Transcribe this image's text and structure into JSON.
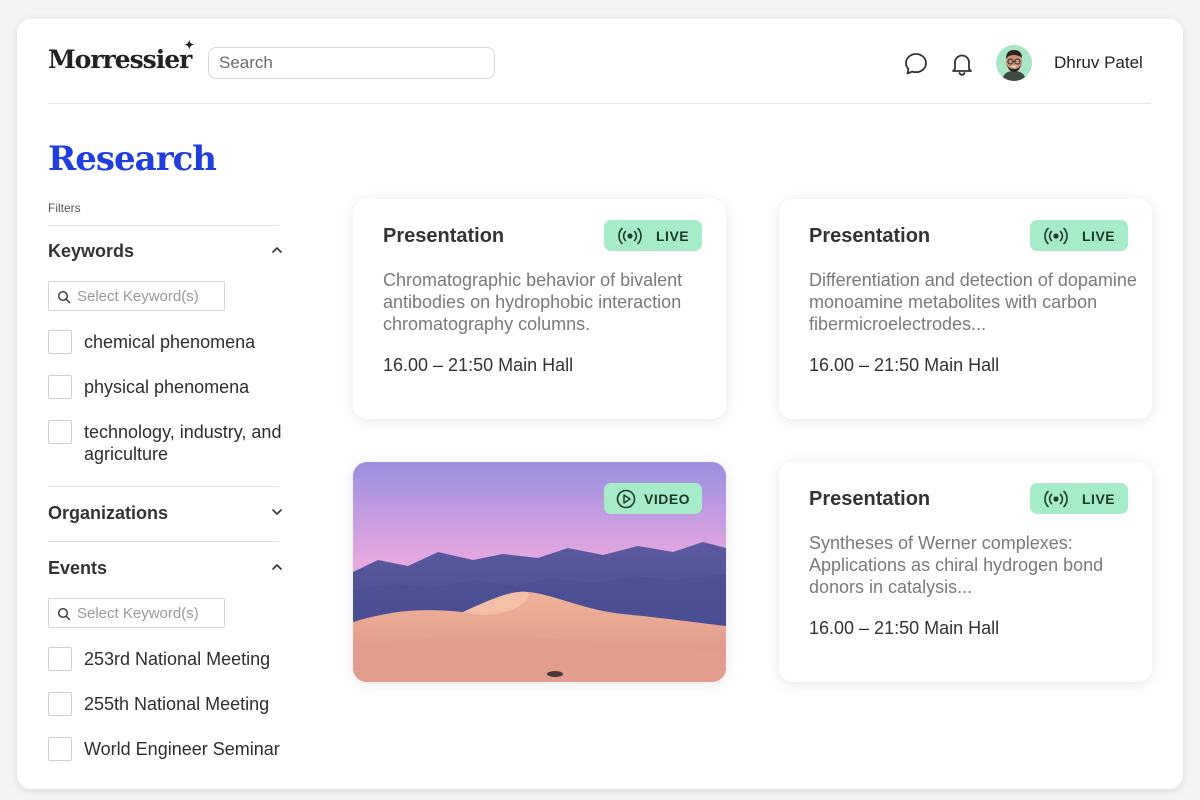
{
  "header": {
    "logo": "Morressier",
    "search_placeholder": "Search",
    "user_name": "Dhruv Patel",
    "icons": [
      "chat-bubble-icon",
      "bell-icon"
    ]
  },
  "sidebar": {
    "title": "Research",
    "filters_label": "Filters",
    "keywords": {
      "title": "Keywords",
      "expanded": true,
      "input_placeholder": "Select Keyword(s)",
      "items": [
        "chemical phenomena",
        "physical phenomena",
        "technology, industry, and agriculture"
      ]
    },
    "organizations": {
      "title": "Organizations",
      "expanded": false
    },
    "events": {
      "title": "Events",
      "expanded": true,
      "input_placeholder": "Select Keyword(s)",
      "items": [
        "253rd National Meeting",
        "255th National Meeting",
        "World Engineer Seminar"
      ]
    }
  },
  "cards": [
    {
      "type": "Presentation",
      "badge": "LIVE",
      "description": "Chromatographic behavior of bivalent antibodies on hydrophobic interaction chromatography columns.",
      "meta": "16.00 – 21:50 Main Hall"
    },
    {
      "type": "Presentation",
      "badge": "LIVE",
      "description": "Differentiation and detection of dopamine monoamine metabolites with carbon fibermicroelectrodes...",
      "meta": "16.00 – 21:50 Main Hall"
    },
    {
      "badge": "VIDEO"
    },
    {
      "type": "Presentation",
      "badge": "LIVE",
      "description": "Syntheses of Werner complexes: Applications as chiral hydrogen bond donors in catalysis...",
      "meta": "16.00 – 21:50 Main Hall"
    }
  ],
  "colors": {
    "brand_blue": "#1f3ee0",
    "badge_green": "#a7ecc9",
    "avatar_bg": "#a8e6c5"
  }
}
